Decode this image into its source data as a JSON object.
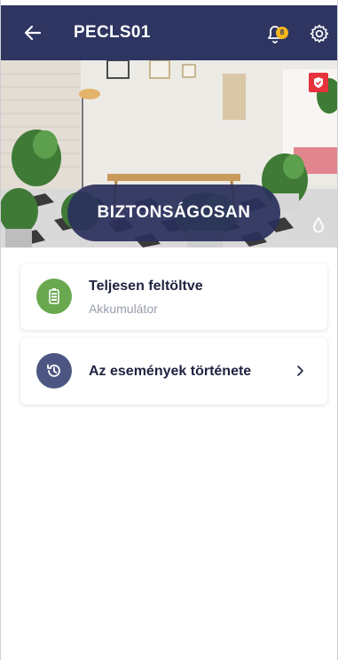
{
  "header": {
    "title": "PECLS01",
    "notification_count": "8",
    "background_color": "#2e3561"
  },
  "hero": {
    "status_label": "BIZTONSÁGOSAN"
  },
  "cards": {
    "battery": {
      "title": "Teljesen feltöltve",
      "subtitle": "Akkumulátor",
      "icon": "battery-icon",
      "icon_color": "#6aa84f"
    },
    "history": {
      "title": "Az események története",
      "icon": "history-icon",
      "icon_color": "#4d5683"
    }
  },
  "colors": {
    "accent": "#2e3561",
    "badge": "#f2b61c",
    "shield": "#e5323b"
  }
}
